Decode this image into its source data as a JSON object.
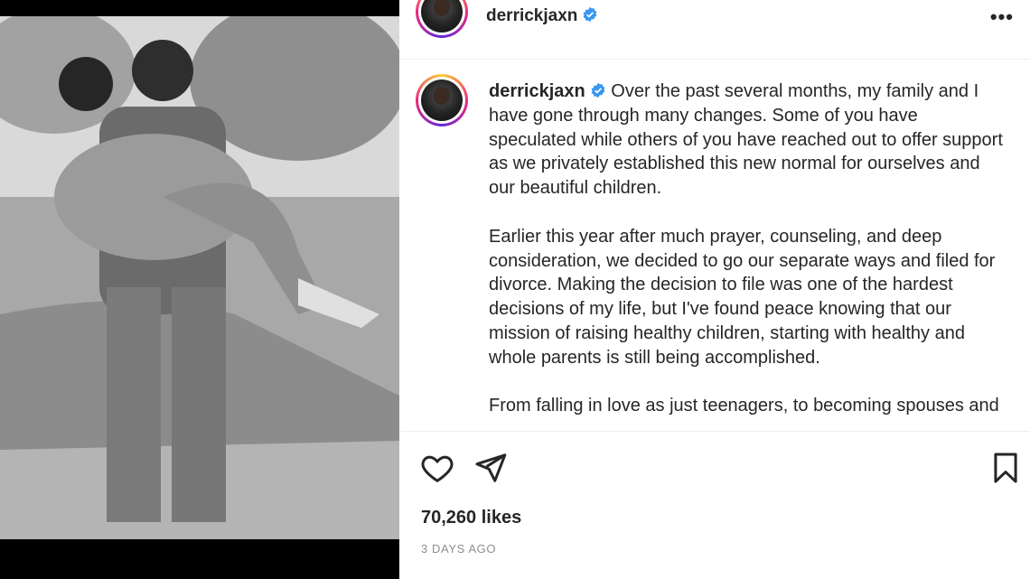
{
  "post": {
    "username": "derrickjaxn",
    "caption": {
      "p1": "Over the past several months, my family and I have gone through many changes. Some of you have speculated while others of you have reached out to offer support as we privately established this new normal for ourselves and our beautiful children.",
      "p2": "Earlier this year after much prayer, counseling, and deep consideration, we decided to go our separate ways and filed for divorce. Making the decision to file was one of the hardest decisions of my life, but I've found peace knowing that our mission of raising healthy children, starting with healthy and whole parents is still being accomplished.",
      "p3": "From falling in love as just teenagers, to becoming spouses and"
    },
    "likes": "70,260 likes",
    "time": "3 DAYS AGO"
  },
  "icons": {
    "more": "more-options-icon",
    "like": "heart-icon",
    "share": "send-icon",
    "save": "bookmark-icon",
    "verified": "verified-badge-icon"
  },
  "colors": {
    "verified": "#3897f0",
    "text": "#262626",
    "muted": "#8e8e8e"
  },
  "more_label": "•••"
}
